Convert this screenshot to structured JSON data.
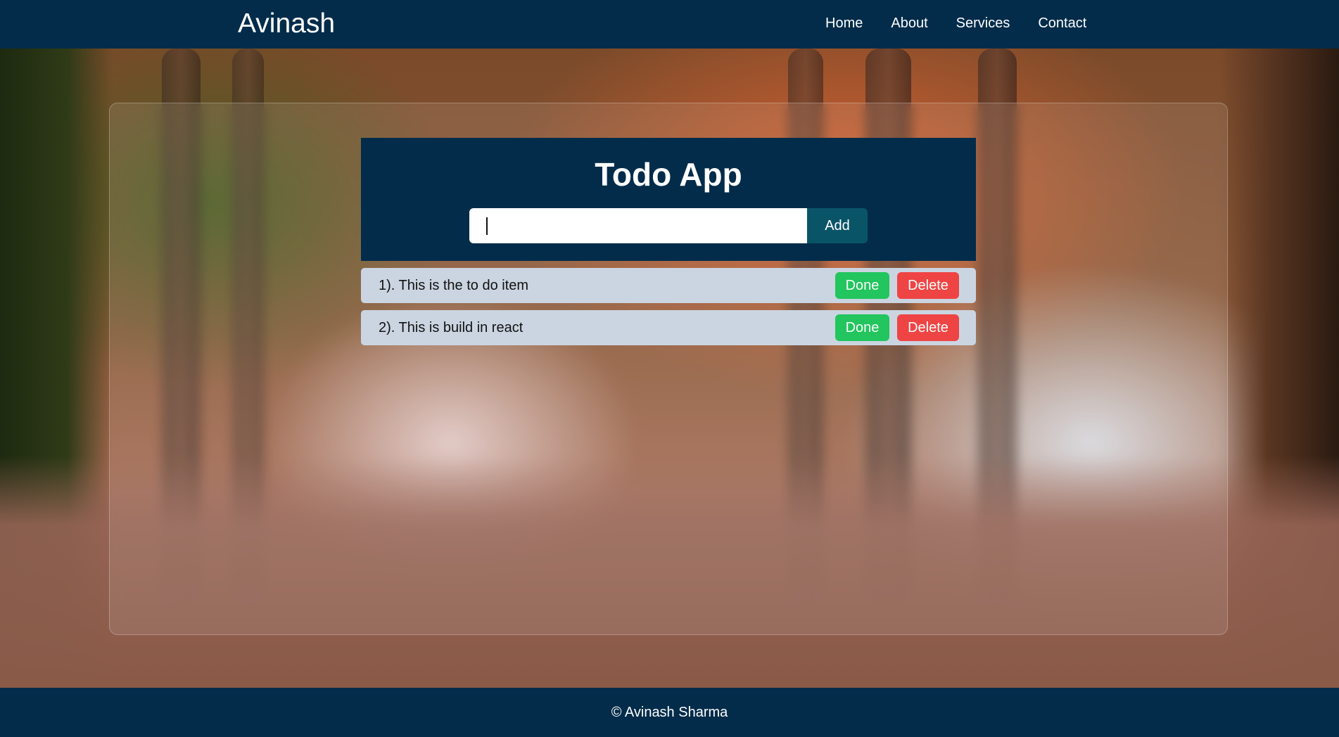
{
  "navbar": {
    "brand": "Avinash",
    "links": [
      "Home",
      "About",
      "Services",
      "Contact"
    ]
  },
  "todo": {
    "title": "Todo App",
    "input_value": "",
    "add_label": "Add",
    "items": [
      {
        "text": "1). This is the to do item",
        "done_label": "Done",
        "delete_label": "Delete"
      },
      {
        "text": "2). This is build in react",
        "done_label": "Done",
        "delete_label": "Delete"
      }
    ]
  },
  "footer": {
    "text": "© Avinash Sharma"
  },
  "colors": {
    "navy": "#022c4a",
    "add_button": "#0a5468",
    "done_button": "#22c55e",
    "delete_button": "#ef4444",
    "item_background": "#cbd5e1"
  }
}
